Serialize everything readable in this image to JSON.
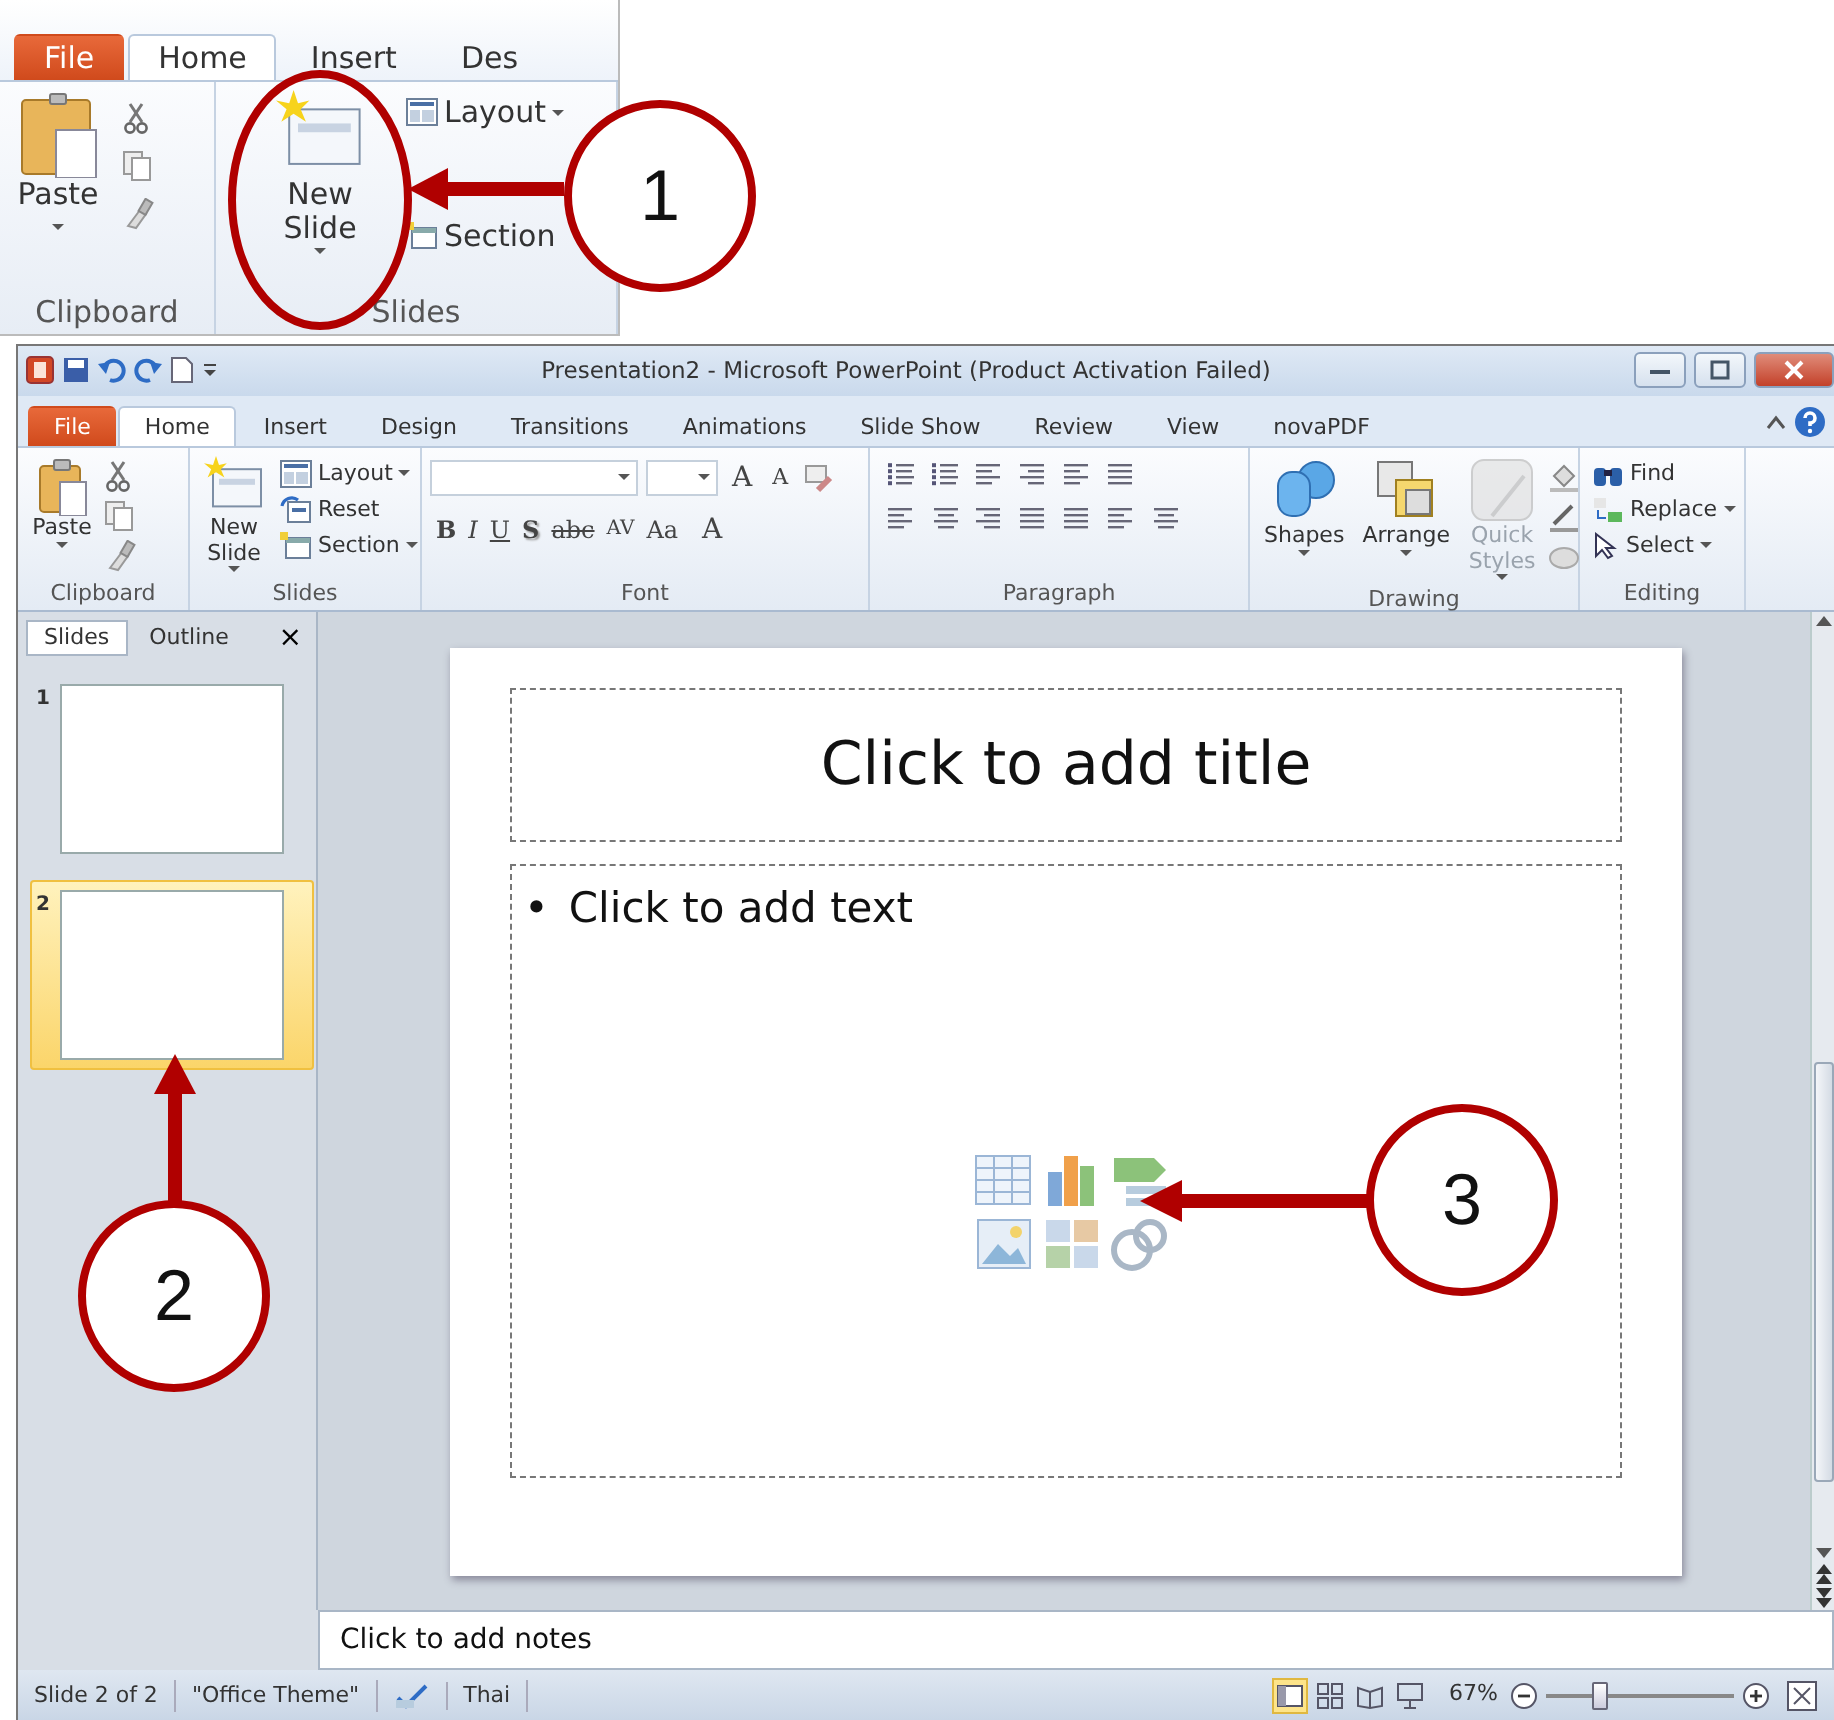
{
  "inset": {
    "tabs": [
      {
        "label": "File",
        "kind": "file",
        "selected": false
      },
      {
        "label": "Home",
        "kind": "tab",
        "selected": true
      },
      {
        "label": "Insert",
        "kind": "tab",
        "selected": false
      },
      {
        "label": "Des",
        "kind": "tab",
        "selected": false
      }
    ],
    "groups": [
      {
        "kind": "clipboard",
        "label": "Clipboard",
        "big": "Paste"
      },
      {
        "kind": "slides",
        "label": "Slides",
        "big": "New Slide",
        "small": [
          "Layout",
          "Section"
        ]
      }
    ]
  },
  "window": {
    "title": "Presentation2 - Microsoft PowerPoint (Product Activation Failed)"
  },
  "tabs": [
    {
      "label": "File",
      "kind": "file",
      "selected": false
    },
    {
      "label": "Home",
      "kind": "tab",
      "selected": true
    },
    {
      "label": "Insert",
      "kind": "tab",
      "selected": false
    },
    {
      "label": "Design",
      "kind": "tab",
      "selected": false
    },
    {
      "label": "Transitions",
      "kind": "tab",
      "selected": false
    },
    {
      "label": "Animations",
      "kind": "tab",
      "selected": false
    },
    {
      "label": "Slide Show",
      "kind": "tab",
      "selected": false
    },
    {
      "label": "Review",
      "kind": "tab",
      "selected": false
    },
    {
      "label": "View",
      "kind": "tab",
      "selected": false
    },
    {
      "label": "novaPDF",
      "kind": "tab",
      "selected": false
    }
  ],
  "ribbon": [
    {
      "kind": "clipboard",
      "label": "Clipboard",
      "big": [
        {
          "label": "Paste",
          "disabled": false
        }
      ]
    },
    {
      "kind": "slides",
      "label": "Slides",
      "big": [
        {
          "label": "New Slide",
          "disabled": false
        }
      ],
      "small": [
        "Layout",
        "Reset",
        "Section"
      ]
    },
    {
      "kind": "font",
      "label": "Font",
      "top": [
        "A",
        "A"
      ],
      "buttons": [
        "B",
        "I",
        "U",
        "S",
        "abc",
        "AV",
        "Aa",
        "A"
      ]
    },
    {
      "kind": "paragraph",
      "label": "Paragraph"
    },
    {
      "kind": "drawing",
      "label": "Drawing",
      "big": [
        {
          "label": "Shapes",
          "disabled": false
        },
        {
          "label": "Arrange",
          "disabled": false
        },
        {
          "label": "Quick Styles",
          "disabled": true
        }
      ]
    },
    {
      "kind": "editing",
      "label": "Editing",
      "small": [
        "Find",
        "Replace",
        "Select"
      ]
    }
  ],
  "pane": {
    "tabs": [
      {
        "label": "Slides",
        "selected": true
      },
      {
        "label": "Outline",
        "selected": false
      }
    ],
    "close": "×",
    "slides": [
      {
        "number": "1",
        "selected": false
      },
      {
        "number": "2",
        "selected": true
      }
    ]
  },
  "slide": {
    "title": "Click to add title",
    "bullet": "•",
    "body": "Click to add text"
  },
  "notes": "Click to add notes",
  "status_bar": {
    "slide": "Slide 2 of 2",
    "theme": "\"Office Theme\"",
    "language": "Thai",
    "views": [
      {
        "selected": true
      },
      {
        "selected": false
      },
      {
        "selected": false
      },
      {
        "selected": false
      }
    ],
    "zoom": "67%",
    "level": 0.3
  },
  "callouts": [
    {
      "number": "1"
    },
    {
      "number": "2"
    },
    {
      "number": "3"
    }
  ]
}
